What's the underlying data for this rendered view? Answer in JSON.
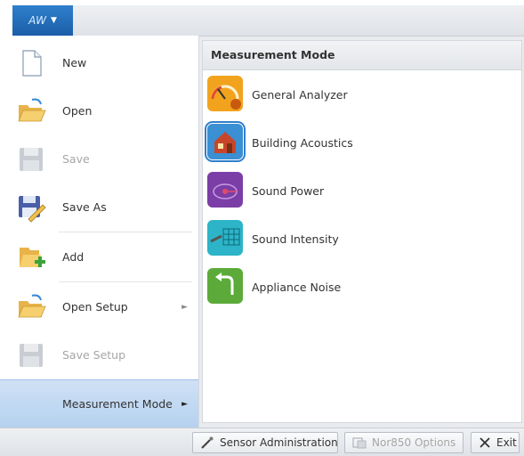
{
  "app_button": {
    "label": "AW",
    "caret": "▼"
  },
  "left_menu": {
    "items": [
      {
        "label": "New",
        "state": "enabled",
        "icon": "new-document-icon"
      },
      {
        "label": "Open",
        "state": "enabled",
        "icon": "open-folder-icon"
      },
      {
        "label": "Save",
        "state": "disabled",
        "icon": "save-disk-icon"
      },
      {
        "label": "Save As",
        "state": "enabled",
        "icon": "save-as-icon"
      },
      {
        "label": "Add",
        "state": "enabled",
        "icon": "add-file-icon"
      },
      {
        "label": "Open Setup",
        "state": "enabled",
        "icon": "open-folder-icon",
        "submenu_arrow": "►"
      },
      {
        "label": "Save Setup",
        "state": "disabled",
        "icon": "save-disk-icon"
      },
      {
        "label": "Measurement Mode",
        "state": "active",
        "submenu_arrow": "►"
      }
    ]
  },
  "measurement_mode": {
    "header": "Measurement Mode",
    "items": [
      {
        "label": "General Analyzer",
        "icon": "gauge-icon",
        "color": "#f2a31e"
      },
      {
        "label": "Building Acoustics",
        "icon": "house-icon",
        "color": "#3b8fd3",
        "selected": true
      },
      {
        "label": "Sound Power",
        "icon": "sound-power-icon",
        "color": "#7b3ea6"
      },
      {
        "label": "Sound Intensity",
        "icon": "intensity-probe-icon",
        "color": "#2db4c8"
      },
      {
        "label": "Appliance Noise",
        "icon": "appliance-arrow-icon",
        "color": "#5cab3a"
      }
    ]
  },
  "bottom_bar": {
    "sensor_admin": "Sensor Administration",
    "options": "Nor850 Options",
    "exit": "Exit"
  },
  "colors": {
    "accent": "#2f7fcc",
    "active_row": "#c4dbf3"
  }
}
